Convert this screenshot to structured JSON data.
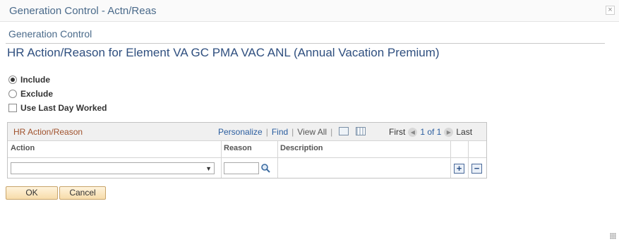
{
  "window": {
    "title": "Generation Control - Actn/Reas",
    "close_glyph": "×"
  },
  "page": {
    "sub_heading": "Generation Control",
    "title": "HR Action/Reason for Element VA GC PMA VAC ANL (Annual Vacation Premium)"
  },
  "options": {
    "include_label": "Include",
    "include_selected": true,
    "exclude_label": "Exclude",
    "exclude_selected": false,
    "use_last_day_label": "Use Last Day Worked",
    "use_last_day_checked": false
  },
  "grid": {
    "title": "HR Action/Reason",
    "personalize": "Personalize",
    "find": "Find",
    "view_all": "View All",
    "first": "First",
    "page_count": "1 of 1",
    "last": "Last",
    "columns": {
      "action": "Action",
      "reason": "Reason",
      "description": "Description"
    },
    "rows": [
      {
        "action": "",
        "reason": "",
        "description": ""
      }
    ],
    "add_glyph": "+",
    "delete_glyph": "−"
  },
  "buttons": {
    "ok": "OK",
    "cancel": "Cancel"
  },
  "colors": {
    "title_blue": "#2f4f7f",
    "grid_title": "#a0522d",
    "link_blue": "#2a5d9f",
    "button_fill": "#f7dcaa"
  },
  "icons": {
    "close": "close-icon",
    "lookup": "search-icon",
    "zoom": "zoom-grid-icon",
    "download": "download-spreadsheet-icon",
    "prev": "chevron-left-icon",
    "next": "chevron-right-icon",
    "add_row": "plus-icon",
    "delete_row": "minus-icon"
  }
}
